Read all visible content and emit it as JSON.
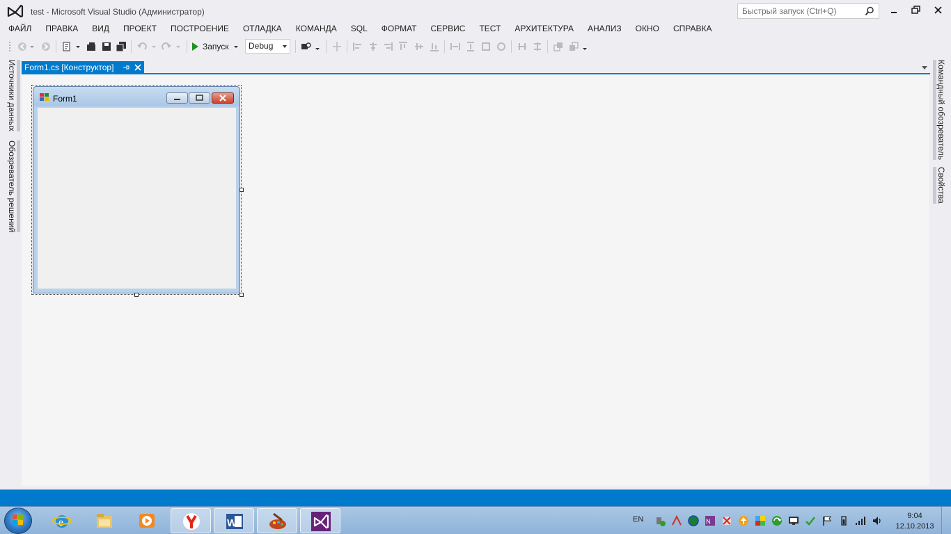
{
  "window": {
    "title": "test - Microsoft Visual Studio (Администратор)",
    "quick_launch_placeholder": "Быстрый запуск (Ctrl+Q)"
  },
  "menu": {
    "items": [
      {
        "label": "ФАЙЛ"
      },
      {
        "label": "ПРАВКА"
      },
      {
        "label": "ВИД"
      },
      {
        "label": "ПРОЕКТ"
      },
      {
        "label": "ПОСТРОЕНИЕ"
      },
      {
        "label": "ОТЛАДКА"
      },
      {
        "label": "КОМАНДА"
      },
      {
        "label": "SQL"
      },
      {
        "label": "ФОРМАТ"
      },
      {
        "label": "СЕРВИС"
      },
      {
        "label": "ТЕСТ"
      },
      {
        "label": "АРХИТЕКТУРА"
      },
      {
        "label": "АНАЛИЗ"
      },
      {
        "label": "ОКНО"
      },
      {
        "label": "СПРАВКА"
      }
    ]
  },
  "toolbar": {
    "run_label": "Запуск",
    "config_value": "Debug"
  },
  "left_panels": {
    "data_sources": "Источники данных",
    "solution_explorer": "Обозреватель решений"
  },
  "right_panels": {
    "team_explorer": "Командный обозреватель",
    "properties": "Свойства"
  },
  "document": {
    "tab_label": "Form1.cs [Конструктор]"
  },
  "form": {
    "title": "Form1"
  },
  "taskbar": {
    "language": "EN",
    "time": "9:04",
    "date": "12.10.2013"
  },
  "colors": {
    "accent": "#007acc",
    "vs_purple": "#68217a",
    "designer_bg": "#f5f5f5"
  }
}
